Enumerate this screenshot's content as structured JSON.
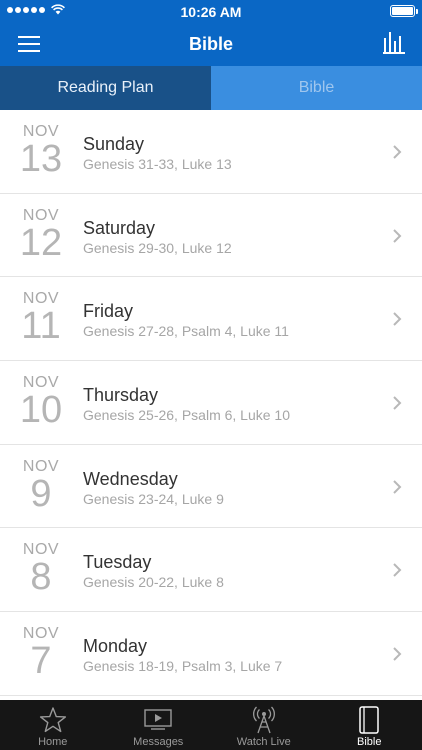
{
  "status_bar": {
    "time": "10:26 AM"
  },
  "nav": {
    "title": "Bible"
  },
  "segment": {
    "tabs": [
      "Reading Plan",
      "Bible"
    ],
    "active": "Reading Plan"
  },
  "readings": [
    {
      "month": "NOV",
      "day": "13",
      "weekday": "Sunday",
      "passage": "Genesis 31-33, Luke 13"
    },
    {
      "month": "NOV",
      "day": "12",
      "weekday": "Saturday",
      "passage": "Genesis 29-30, Luke 12"
    },
    {
      "month": "NOV",
      "day": "11",
      "weekday": "Friday",
      "passage": "Genesis 27-28, Psalm 4, Luke 11"
    },
    {
      "month": "NOV",
      "day": "10",
      "weekday": "Thursday",
      "passage": "Genesis 25-26, Psalm 6, Luke 10"
    },
    {
      "month": "NOV",
      "day": "9",
      "weekday": "Wednesday",
      "passage": "Genesis 23-24, Luke 9"
    },
    {
      "month": "NOV",
      "day": "8",
      "weekday": "Tuesday",
      "passage": "Genesis 20-22, Luke 8"
    },
    {
      "month": "NOV",
      "day": "7",
      "weekday": "Monday",
      "passage": "Genesis 18-19, Psalm 3, Luke 7"
    }
  ],
  "tabbar": {
    "items": [
      {
        "label": "Home",
        "icon": "star-icon"
      },
      {
        "label": "Messages",
        "icon": "video-play-icon"
      },
      {
        "label": "Watch Live",
        "icon": "broadcast-tower-icon"
      },
      {
        "label": "Bible",
        "icon": "book-icon"
      }
    ],
    "active": "Bible"
  },
  "colors": {
    "brand_blue": "#0a67c5",
    "segment_active": "#195188",
    "segment_inactive": "#3a8ee0",
    "tabbar_bg": "#161616"
  }
}
